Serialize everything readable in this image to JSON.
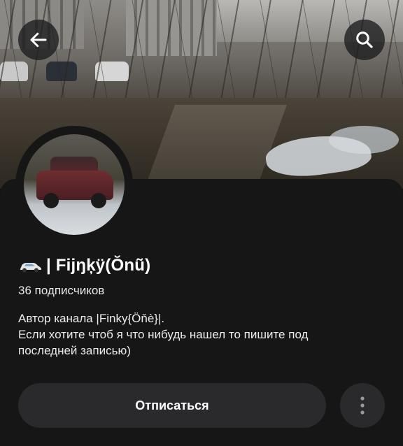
{
  "header": {
    "back_icon": "arrow-left-icon",
    "search_icon": "search-icon"
  },
  "channel": {
    "title_prefix_icon": "car-icon",
    "title": "| Fijŋķÿ(Ŏnũ)",
    "subscribers": "36 подписчиков",
    "description": [
      "Автор канала |Finky{Öňè}|.",
      "Если хотите чтоб я что нибудь нашел то пишите под",
      "последней записью)"
    ]
  },
  "actions": {
    "unsubscribe_label": "Отписаться",
    "more_icon": "more-vertical-icon"
  },
  "colors": {
    "background": "#161617",
    "button": "#2a2a2c",
    "text": "#ffffff"
  }
}
